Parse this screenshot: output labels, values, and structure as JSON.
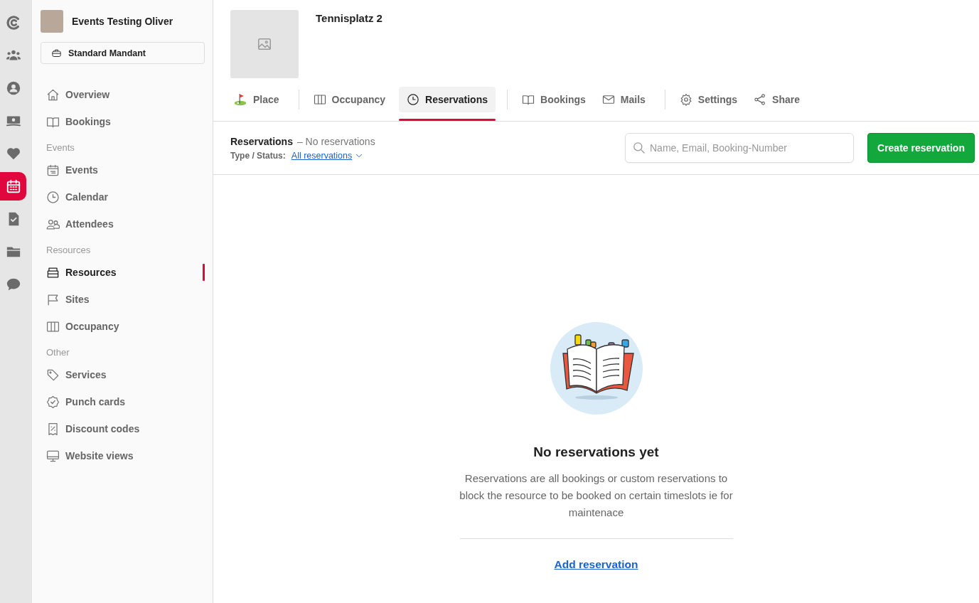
{
  "rail": [
    {
      "selected": false
    },
    {
      "selected": false
    },
    {
      "selected": false
    },
    {
      "selected": false
    },
    {
      "selected": false
    },
    {
      "selected": true
    },
    {
      "selected": false
    },
    {
      "selected": false
    },
    {
      "selected": false
    }
  ],
  "sidebar": {
    "org_name": "Events Testing Oliver",
    "tenant": "Standard Mandant",
    "sections": [
      {
        "items": [
          {
            "label": "Overview",
            "selected": false
          },
          {
            "label": "Bookings",
            "selected": false
          }
        ]
      },
      {
        "title": "Events",
        "items": [
          {
            "label": "Events",
            "selected": false
          },
          {
            "label": "Calendar",
            "selected": false
          },
          {
            "label": "Attendees",
            "selected": false
          }
        ]
      },
      {
        "title": "Resources",
        "items": [
          {
            "label": "Resources",
            "selected": true
          },
          {
            "label": "Sites",
            "selected": false
          },
          {
            "label": "Occupancy",
            "selected": false
          }
        ]
      },
      {
        "title": "Other",
        "items": [
          {
            "label": "Services",
            "selected": false
          },
          {
            "label": "Punch cards",
            "selected": false
          },
          {
            "label": "Discount codes",
            "selected": false
          },
          {
            "label": "Website views",
            "selected": false
          }
        ]
      }
    ]
  },
  "resource": {
    "title": "Tennisplatz 2"
  },
  "tab_groups": [
    {
      "tabs": [
        {
          "label": "Place",
          "selected": false
        }
      ]
    },
    {
      "tabs": [
        {
          "label": "Occupancy",
          "selected": false
        },
        {
          "label": "Reservations",
          "selected": true
        }
      ]
    },
    {
      "tabs": [
        {
          "label": "Bookings",
          "selected": false
        },
        {
          "label": "Mails",
          "selected": false
        }
      ]
    },
    {
      "tabs": [
        {
          "label": "Settings",
          "selected": false
        },
        {
          "label": "Share",
          "selected": false
        }
      ]
    }
  ],
  "toolbar": {
    "heading": "Reservations",
    "count_text": "– No reservations",
    "filter_label": "Type / Status:",
    "filter_value": "All reservations",
    "search": {
      "placeholder": "Name, Email, Booking-Number"
    },
    "create_button": "Create reservation"
  },
  "empty_state": {
    "title": "No reservations yet",
    "text": "Reservations are all bookings or custom reservations to block the resource to be booked on certain timeslots ie for maintenace",
    "link": "Add reservation"
  }
}
